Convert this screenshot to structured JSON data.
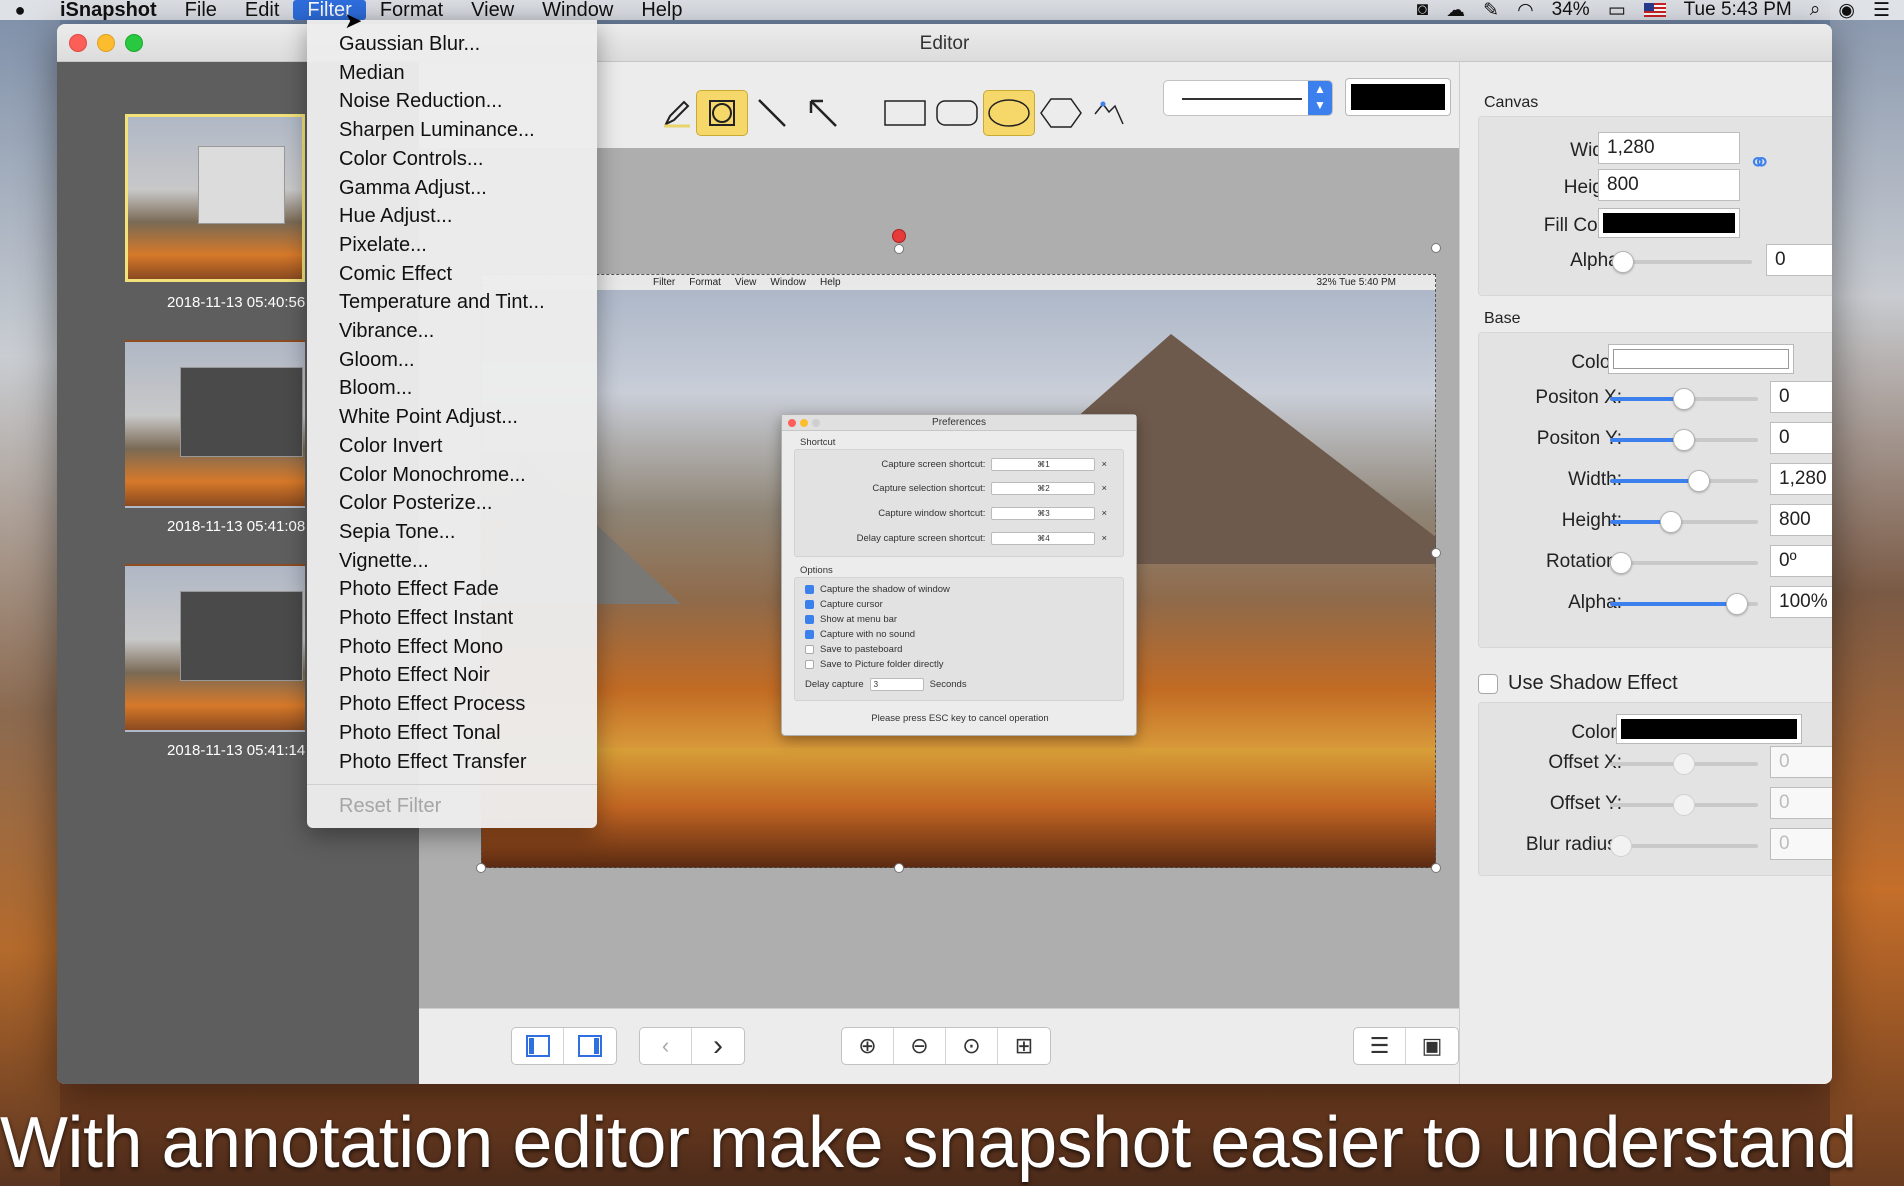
{
  "menubar": {
    "app_name": "iSnapshot",
    "menus": [
      "File",
      "Edit",
      "Filter",
      "Format",
      "View",
      "Window",
      "Help"
    ],
    "active_menu": "Filter",
    "battery": "34%",
    "clock": "Tue 5:43 PM"
  },
  "window": {
    "title": "Editor"
  },
  "sidebar": {
    "thumbnails": [
      {
        "date": "2018-11-13 05:40:56"
      },
      {
        "date": "2018-11-13 05:41:08"
      },
      {
        "date": "2018-11-13 05:41:14"
      }
    ]
  },
  "filter_menu": {
    "items": [
      "Gaussian Blur...",
      "Median",
      "Noise Reduction...",
      "Sharpen Luminance...",
      "Color Controls...",
      "Gamma Adjust...",
      "Hue Adjust...",
      "Pixelate...",
      "Comic Effect",
      "Temperature and Tint...",
      "Vibrance...",
      "Gloom...",
      "Bloom...",
      "White Point Adjust...",
      "Color Invert",
      "Color Monochrome...",
      "Color Posterize...",
      "Sepia Tone...",
      "Vignette...",
      "Photo Effect Fade",
      "Photo Effect Instant",
      "Photo Effect Mono",
      "Photo Effect Noir",
      "Photo Effect Process",
      "Photo Effect Tonal",
      "Photo Effect Transfer"
    ],
    "reset_label": "Reset Filter"
  },
  "toolbar": {
    "stroke_color": "#000000",
    "active_tools": [
      "crop-shape-tool",
      "ellipse-tool"
    ]
  },
  "canvas_preview": {
    "menus": [
      "Filter",
      "Format",
      "View",
      "Window",
      "Help"
    ],
    "menu_right": "32%   Tue 5:40 PM",
    "prefs": {
      "title": "Preferences",
      "shortcut_header": "Shortcut",
      "shortcuts": [
        {
          "label": "Capture screen shortcut:",
          "key": "⌘1"
        },
        {
          "label": "Capture selection shortcut:",
          "key": "⌘2"
        },
        {
          "label": "Capture window shortcut:",
          "key": "⌘3"
        },
        {
          "label": "Delay capture screen shortcut:",
          "key": "⌘4"
        }
      ],
      "options_header": "Options",
      "options": [
        {
          "label": "Capture the shadow of window",
          "checked": true
        },
        {
          "label": "Capture cursor",
          "checked": true
        },
        {
          "label": "Show at menu bar",
          "checked": true
        },
        {
          "label": "Capture with no sound",
          "checked": true
        },
        {
          "label": "Save to pasteboard",
          "checked": false
        },
        {
          "label": "Save to Picture folder directly",
          "checked": false
        }
      ],
      "delay_label": "Delay capture",
      "delay_value": "3",
      "delay_unit": "Seconds",
      "footer": "Please press ESC key to cancel operation"
    }
  },
  "inspector": {
    "canvas": {
      "title": "Canvas",
      "width_label": "Width:",
      "width": "1,280",
      "height_label": "Height:",
      "height": "800",
      "fill_label": "Fill Color:",
      "fill_color": "#000000",
      "alpha_label": "Alpha:",
      "alpha": "0",
      "alpha_level": 0
    },
    "base": {
      "title": "Base",
      "color_label": "Color:",
      "color": "#ffffff",
      "rows": [
        {
          "label": "Positon X:",
          "value": "0",
          "level": 0.5
        },
        {
          "label": "Positon Y:",
          "value": "0",
          "level": 0.5
        },
        {
          "label": "Width:",
          "value": "1,280",
          "level": 0.62
        },
        {
          "label": "Height:",
          "value": "800",
          "level": 0.4
        },
        {
          "label": "Rotation:",
          "value": "0º",
          "level": 0.0
        },
        {
          "label": "Alpha:",
          "value": "100%",
          "level": 0.92
        }
      ]
    },
    "shadow": {
      "checkbox_label": "Use Shadow Effect",
      "checked": false,
      "color_label": "Color:",
      "color": "#000000",
      "rows": [
        {
          "label": "Offset X:",
          "value": "0",
          "level": 0.5
        },
        {
          "label": "Offset Y:",
          "value": "0",
          "level": 0.5
        },
        {
          "label": "Blur radius:",
          "value": "0",
          "level": 0.0
        }
      ]
    }
  },
  "caption": "With annotation editor make snapshot easier to understand"
}
